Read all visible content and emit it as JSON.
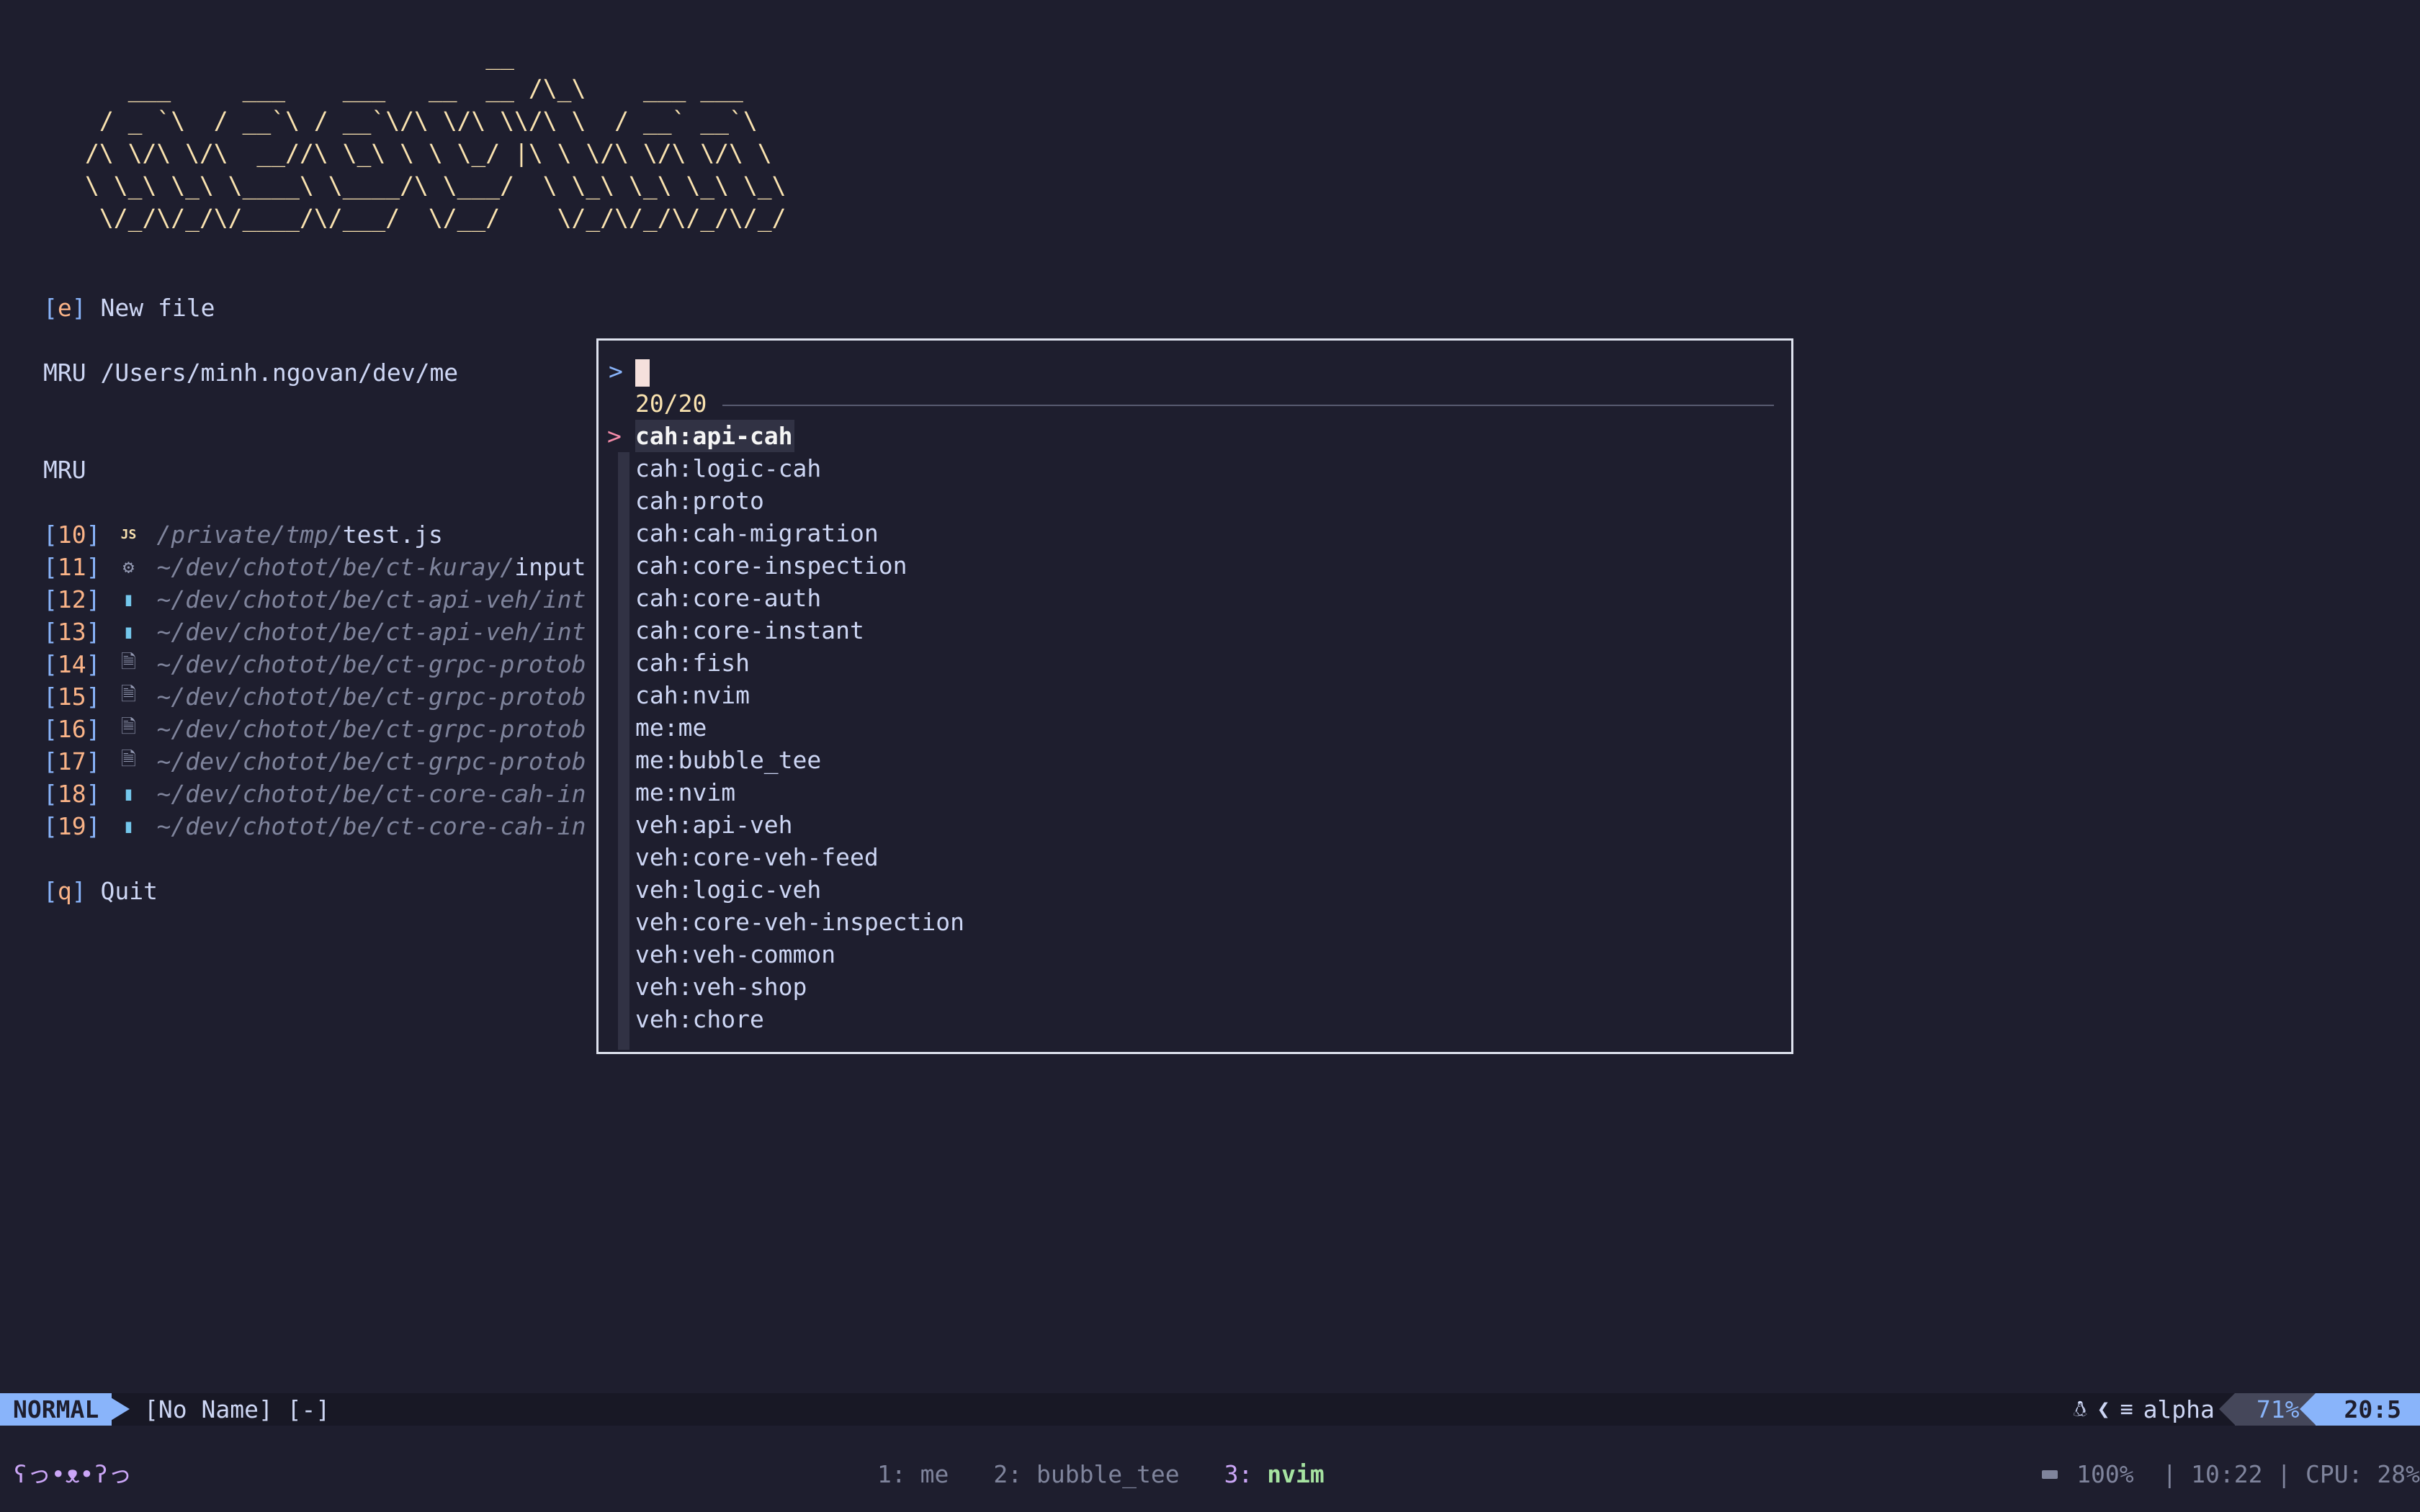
{
  "banner": {
    "lines": [
      "                            __",
      "   ___     ___    ___   __  __ /\\_\\    ___ ___",
      " / _ `\\  / __`\\ / __`\\/\\ \\/\\ \\\\/\\ \\  / __` __`\\",
      "/\\ \\/\\ \\/\\  __//\\ \\_\\ \\ \\ \\_/ |\\ \\ \\/\\ \\/\\ \\/\\ \\",
      "\\ \\_\\ \\_\\ \\____\\ \\____/\\ \\___/  \\ \\_\\ \\_\\ \\_\\ \\_\\",
      " \\/_/\\/_/\\/____/\\/___/  \\/__/    \\/_/\\/_/\\/_/\\/_/"
    ]
  },
  "dashboard": {
    "new_file": {
      "key": "e",
      "label": "New file"
    },
    "mru_dir": {
      "prefix": "MRU",
      "path": "/Users/minh.ngovan/dev/me"
    },
    "mru_heading": "MRU",
    "mru_items": [
      {
        "index": "10",
        "icon": "JS",
        "icon_color": "#f9e2af",
        "dir": "/private/tmp/",
        "file": "test.js"
      },
      {
        "index": "11",
        "icon": "⚙",
        "icon_color": "#9399b2",
        "dir": "~/dev/chotot/be/ct-kuray/",
        "file": "input"
      },
      {
        "index": "12",
        "icon": "▮",
        "icon_color": "#74c7ec",
        "dir": "~/dev/chotot/be/ct-api-veh/int",
        "file": ""
      },
      {
        "index": "13",
        "icon": "▮",
        "icon_color": "#74c7ec",
        "dir": "~/dev/chotot/be/ct-api-veh/int",
        "file": ""
      },
      {
        "index": "14",
        "icon": "🗎",
        "icon_color": "#9399b2",
        "dir": "~/dev/chotot/be/ct-grpc-protob",
        "file": ""
      },
      {
        "index": "15",
        "icon": "🗎",
        "icon_color": "#9399b2",
        "dir": "~/dev/chotot/be/ct-grpc-protob",
        "file": ""
      },
      {
        "index": "16",
        "icon": "🗎",
        "icon_color": "#9399b2",
        "dir": "~/dev/chotot/be/ct-grpc-protob",
        "file": ""
      },
      {
        "index": "17",
        "icon": "🗎",
        "icon_color": "#9399b2",
        "dir": "~/dev/chotot/be/ct-grpc-protob",
        "file": ""
      },
      {
        "index": "18",
        "icon": "▮",
        "icon_color": "#74c7ec",
        "dir": "~/dev/chotot/be/ct-core-cah-in",
        "file": ""
      },
      {
        "index": "19",
        "icon": "▮",
        "icon_color": "#74c7ec",
        "dir": "~/dev/chotot/be/ct-core-cah-in",
        "file": ""
      }
    ],
    "quit": {
      "key": "q",
      "label": "Quit"
    }
  },
  "picker": {
    "prompt": ">",
    "query": "",
    "counter": "20/20",
    "selected_marker": ">",
    "selected_index": 0,
    "items": [
      "cah:api-cah",
      "cah:logic-cah",
      "cah:proto",
      "cah:cah-migration",
      "cah:core-inspection",
      "cah:core-auth",
      "cah:core-instant",
      "cah:fish",
      "cah:nvim",
      "me:me",
      "me:bubble_tee",
      "me:nvim",
      "veh:api-veh",
      "veh:core-veh-feed",
      "veh:logic-veh",
      "veh:core-veh-inspection",
      "veh:veh-common",
      "veh:veh-shop",
      "veh:chore"
    ]
  },
  "statusline": {
    "mode": "NORMAL",
    "buffer": "[No Name] [-]",
    "filetype": "alpha",
    "percent": "71%",
    "position": "20:5"
  },
  "tmux": {
    "face": "ʕっ•ᴥ•ʔっ",
    "windows": [
      {
        "num": "1:",
        "name": "me",
        "active": false
      },
      {
        "num": "2:",
        "name": "bubble_tee",
        "active": false
      },
      {
        "num": "3:",
        "name": "nvim",
        "active": true
      }
    ],
    "battery": "100%",
    "time": "10:22",
    "cpu": "CPU: 28%"
  }
}
